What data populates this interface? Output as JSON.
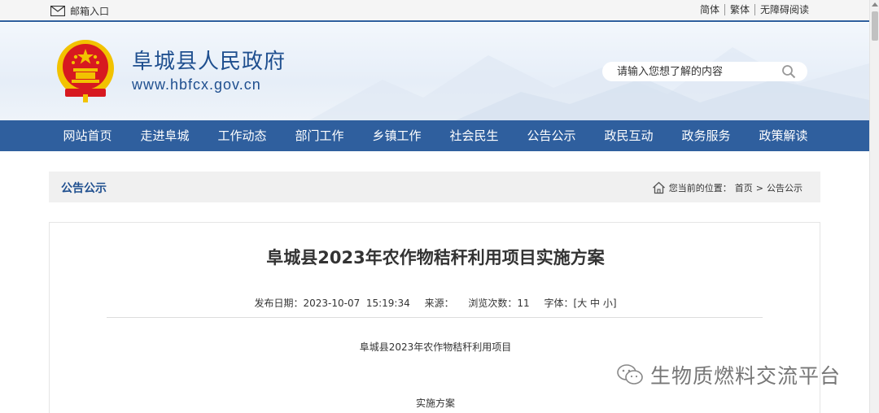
{
  "topbar": {
    "mail_label": "邮箱入口",
    "languages": [
      "简体",
      "繁体",
      "无障碍阅读"
    ]
  },
  "header": {
    "site_title": "阜城县人民政府",
    "site_url": "www.hbfcx.gov.cn",
    "search_placeholder": "请输入您想了解的内容"
  },
  "nav": {
    "items": [
      "网站首页",
      "走进阜城",
      "工作动态",
      "部门工作",
      "乡镇工作",
      "社会民生",
      "公告公示",
      "政民互动",
      "政务服务",
      "政策解读"
    ]
  },
  "section": {
    "title": "公告公示",
    "location_prefix": "您当前的位置：",
    "crumbs": [
      "首页",
      ">",
      "公告公示"
    ]
  },
  "article": {
    "title": "阜城县2023年农作物秸秆利用项目实施方案",
    "meta": {
      "date_label": "发布日期：",
      "date_value": "2023-10-07  15:19:34",
      "source_label": "来源：",
      "source_value": "",
      "views_label": "浏览次数：",
      "views_value": "11",
      "font_label": "字体：",
      "font_options": "[大 中 小]"
    },
    "paragraph1": "阜城县2023年农作物秸秆利用项目",
    "paragraph2": "实施方案"
  },
  "watermark": {
    "text": "生物质燃料交流平台"
  },
  "colors": {
    "brand_blue": "#2f5f9e",
    "title_blue": "#1f4f8f",
    "emblem_red": "#d71920",
    "emblem_gold": "#f2c200"
  }
}
